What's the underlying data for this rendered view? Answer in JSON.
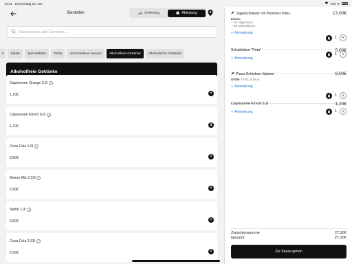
{
  "status_bar": {
    "time": "14:21",
    "date": "Donnerstag 25. Jan.",
    "battery": "100 %"
  },
  "header": {
    "title": "Bestellen",
    "delivery_label": "Lieferung",
    "pickup_label": "Abholung",
    "active_mode": "Abholung"
  },
  "search": {
    "placeholder": "Durchsuche alle Gerichte...",
    "value": ""
  },
  "categories": {
    "partial_label": "s",
    "items": [
      "Salate",
      "Spezialitäten",
      "Pizza",
      "Verschiedene Saucen",
      "Alkoholfreie Getränke",
      "Alkoholische Getränke"
    ],
    "active": "Alkoholfreie Getränke"
  },
  "section_title": "Alkoholfreie Getränke",
  "products": [
    {
      "name": "Caprisonne Orange 0,2l",
      "price": "1,20€",
      "qty_label": "+"
    },
    {
      "name": "Caprisonne Kirsch 0,2l",
      "price": "1,20€",
      "qty_label": "1"
    },
    {
      "name": "Coca Cola 1,0l",
      "price": "3,50€",
      "qty_label": "+"
    },
    {
      "name": "Mezzo Mix 0,33l",
      "price": "2,50€",
      "qty_label": "+"
    },
    {
      "name": "Sprite 1,0l",
      "price": "3,50€",
      "qty_label": "+"
    },
    {
      "name": "Coca Cola 0,33l",
      "price": "2,50€",
      "qty_label": "+"
    }
  ],
  "cart": {
    "items": [
      {
        "title": "Jägerschnitzel mit Pommes frites",
        "price": "13,00€",
        "extras_heading": "Extras:",
        "extras": [
          "+ mit Jägersauce",
          "+ mit Metaxasauce"
        ],
        "note_label": "Anmerkung",
        "qty": "1"
      },
      {
        "title": "Schafskäse \"Feta\"",
        "price": "5,00€",
        "note_label": "Anmerkung",
        "qty": "1"
      },
      {
        "title": "Pizza Schinken-Salami",
        "price": "8,00€",
        "size_label": "Größe:",
        "size_value": "Groß, Ø 28cm",
        "note_label": "Anmerkung",
        "qty": "1"
      },
      {
        "title": "Caprisonne Kirsch 0,2l",
        "price": "1,20€",
        "note_label": "Anmerkung",
        "qty": "1"
      }
    ],
    "subtotal_label": "Zwischensumme",
    "subtotal_value": "27,20€",
    "total_label": "Gesamt",
    "total_value": "27,20€",
    "checkout_label": "Zur Kasse gehen"
  },
  "colors": {
    "accent": "#111111",
    "link": "#1f6fd6",
    "background": "#f2f2f2"
  }
}
